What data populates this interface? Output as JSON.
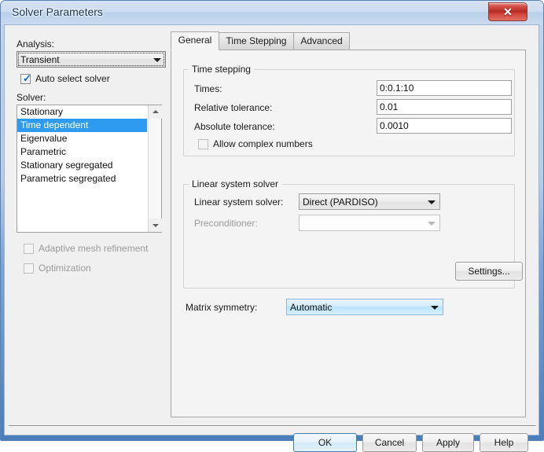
{
  "window": {
    "title": "Solver Parameters",
    "close_glyph": "✕"
  },
  "left_panel": {
    "analysis_label": "Analysis:",
    "analysis_value": "Transient",
    "auto_select_label": "Auto select solver",
    "auto_select_checked": true,
    "solver_label": "Solver:",
    "solver_items": [
      "Stationary",
      "Time dependent",
      "Eigenvalue",
      "Parametric",
      "Stationary segregated",
      "Parametric segregated"
    ],
    "solver_selected_index": 1,
    "adaptive_mesh_label": "Adaptive mesh refinement",
    "adaptive_mesh_checked": false,
    "optimization_label": "Optimization",
    "optimization_checked": false
  },
  "tabs": [
    {
      "label": "General",
      "active": true
    },
    {
      "label": "Time Stepping",
      "active": false
    },
    {
      "label": "Advanced",
      "active": false
    }
  ],
  "time_stepping_group": {
    "title": "Time stepping",
    "fields": [
      {
        "label": "Times:",
        "value": "0:0.1:10"
      },
      {
        "label": "Relative tolerance:",
        "value": "0.01"
      },
      {
        "label": "Absolute tolerance:",
        "value": "0.0010"
      }
    ],
    "allow_complex_label": "Allow complex numbers",
    "allow_complex_checked": false
  },
  "linear_solver_group": {
    "title": "Linear system solver",
    "solver_label": "Linear system solver:",
    "solver_value": "Direct (PARDISO)",
    "preconditioner_label": "Preconditioner:",
    "preconditioner_value": "",
    "settings_button": "Settings..."
  },
  "matrix_symmetry": {
    "label": "Matrix symmetry:",
    "value": "Automatic"
  },
  "footer": {
    "ok": "OK",
    "cancel": "Cancel",
    "apply": "Apply",
    "help": "Help"
  },
  "colors": {
    "selection_blue": "#2e9bf0",
    "title_text": "#16335c",
    "panel_bg": "#f0f0f0",
    "tabpanel_bg": "#f4f4f4",
    "close_red": "#b32a23",
    "default_button_border": "#3c7fb1"
  }
}
